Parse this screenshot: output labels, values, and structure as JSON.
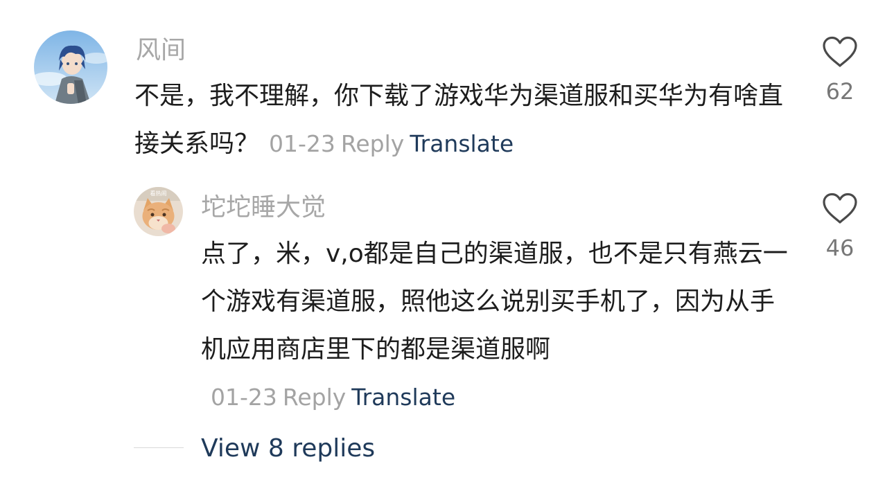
{
  "comments": [
    {
      "username": "风间",
      "text": "不是，我不理解，你下载了游戏华为渠道服和买华为有啥直接关系吗？",
      "date": "01-23",
      "reply_label": "Reply",
      "translate_label": "Translate",
      "likes": "62",
      "avatar_icon": "anime-boy-avatar"
    },
    {
      "username": "坨坨睡大觉",
      "text": "点了，米，v,o都是自己的渠道服，也不是只有燕云一个游戏有渠道服，照他这么说别买手机了，因为从手机应用商店里下的都是渠道服啊",
      "date": "01-23",
      "reply_label": "Reply",
      "translate_label": "Translate",
      "likes": "46",
      "avatar_icon": "cat-avatar",
      "avatar_caption": "看热闹"
    }
  ],
  "view_replies_label": "View 8 replies",
  "colors": {
    "username": "#a7a7a7",
    "body_text": "#1d1d1d",
    "meta": "#a3a3a3",
    "link": "#1f3a5a",
    "like_count": "#777777"
  }
}
